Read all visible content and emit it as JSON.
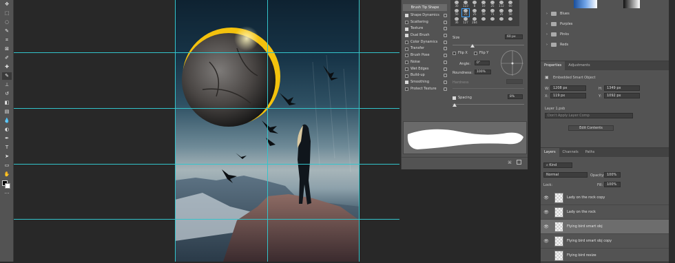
{
  "tools": [
    "move-icon",
    "marquee-icon",
    "lasso-icon",
    "quick-select-icon",
    "crop-icon",
    "frame-icon",
    "eyedropper-icon",
    "spot-heal-icon",
    "brush-icon",
    "stamp-icon",
    "history-brush-icon",
    "eraser-icon",
    "gradient-icon",
    "blur-icon",
    "dodge-icon",
    "pen-icon",
    "type-icon",
    "path-select-icon",
    "rectangle-icon",
    "hand-icon",
    "zoom-icon",
    "more-icon"
  ],
  "tool_glyphs": [
    "✥",
    "⬚",
    "◌",
    "✎",
    "⌗",
    "⊠",
    "✐",
    "✚",
    "✎",
    "⊥",
    "↺",
    "◧",
    "▤",
    "💧",
    "◐",
    "✒",
    "T",
    "➤",
    "▭",
    "✋",
    "🔍",
    "…"
  ],
  "brush_panel": {
    "tip_shape_label": "Brush Tip Shape",
    "options": [
      {
        "label": "Shape Dynamics",
        "checked": true
      },
      {
        "label": "Scattering",
        "checked": false
      },
      {
        "label": "Texture",
        "checked": true
      },
      {
        "label": "Dual Brush",
        "checked": true
      },
      {
        "label": "Color Dynamics",
        "checked": false
      },
      {
        "label": "Transfer",
        "checked": false
      },
      {
        "label": "Brush Pose",
        "checked": false
      },
      {
        "label": "Noise",
        "checked": false
      },
      {
        "label": "Wet Edges",
        "checked": false
      },
      {
        "label": "Build-up",
        "checked": false
      },
      {
        "label": "Smoothing",
        "checked": true
      },
      {
        "label": "Protect Texture",
        "checked": false
      }
    ],
    "tip_sizes": [
      "30",
      "123",
      "8",
      "10",
      "25",
      "112",
      "60",
      "50",
      "25",
      "25",
      "50",
      "71",
      "25",
      "50",
      "36",
      "127",
      "284",
      "",
      "",
      "",
      ""
    ],
    "size_label": "Size",
    "size_value": "60 px",
    "flip_x": "Flip X",
    "flip_y": "Flip Y",
    "angle_label": "Angle:",
    "angle_value": "0°",
    "roundness_label": "Roundness:",
    "roundness_value": "100%",
    "hardness_label": "Hardness",
    "spacing_label": "Spacing",
    "spacing_value": "8%",
    "spacing_checked": true
  },
  "swatch_groups": [
    "Blues",
    "Purples",
    "Pinks",
    "Reds"
  ],
  "properties": {
    "tabs": [
      "Properties",
      "Adjustments"
    ],
    "object_type": "Embedded Smart Object",
    "w_label": "W:",
    "w_value": "1208 px",
    "h_label": "H:",
    "h_value": "1349 px",
    "x_label": "X:",
    "x_value": "119 px",
    "y_label": "Y:",
    "y_value": "1092 px",
    "layer_name": "Layer 1.psb",
    "comp_placeholder": "Don't Apply Layer Comp",
    "edit_button": "Edit Contents"
  },
  "layers_panel": {
    "tabs": [
      "Layers",
      "Channels",
      "Paths"
    ],
    "filter_kind": "Kind",
    "blend_mode": "Normal",
    "opacity_label": "Opacity:",
    "opacity_value": "100%",
    "lock_label": "Lock:",
    "fill_label": "Fill:",
    "fill_value": "100%",
    "layers": [
      {
        "name": "Lady on the rock copy",
        "visible": true,
        "selected": false
      },
      {
        "name": "Lady on the rock",
        "visible": true,
        "selected": false
      },
      {
        "name": "Flying bird smart obj",
        "visible": true,
        "selected": true
      },
      {
        "name": "Flying bird smart obj copy",
        "visible": true,
        "selected": false
      },
      {
        "name": "Flying bird resize",
        "visible": false,
        "selected": false
      }
    ]
  },
  "colors": {
    "guide": "#33c5cc",
    "panel": "#535353",
    "eclipse_ring": "#f4c20d"
  }
}
